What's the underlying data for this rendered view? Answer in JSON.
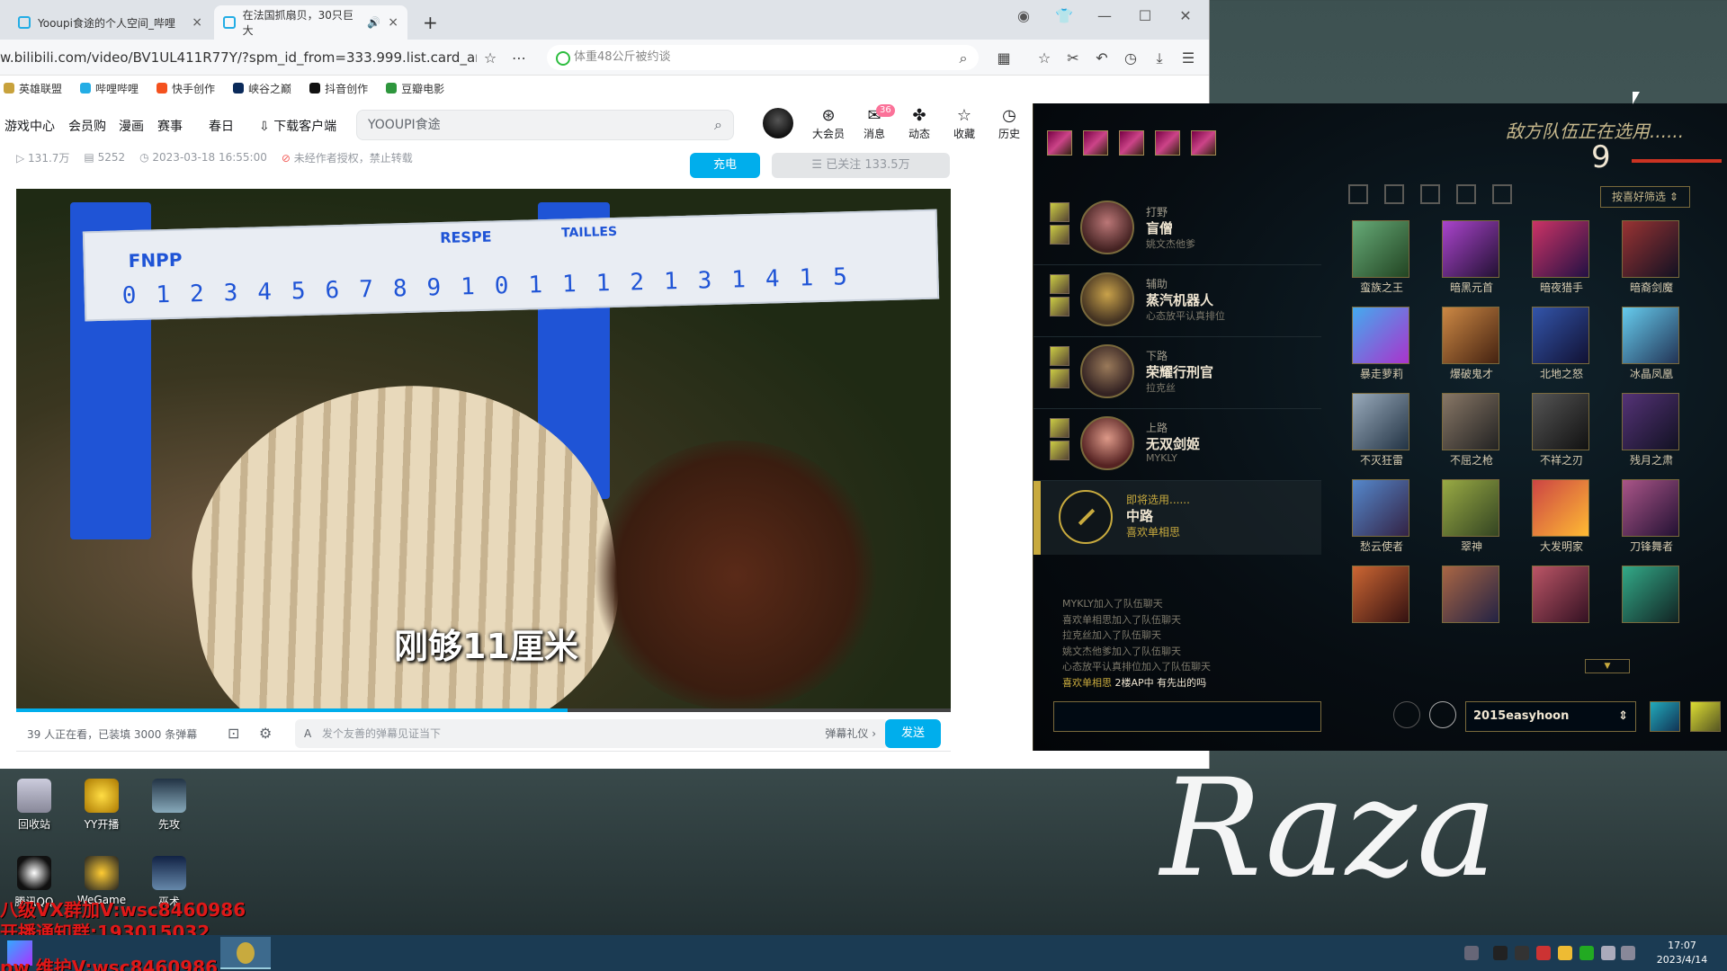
{
  "browser": {
    "tabs": [
      {
        "title": "Yooupi食途的个人空间_哔哩"
      },
      {
        "title": "在法国抓扇贝，30只巨大"
      }
    ],
    "url": "w.bilibili.com/video/BV1UL411R77Y/?spm_id_from=333.999.list.card_archive.clic",
    "search_hint": "体重48公斤被约谈",
    "bookmarks": [
      "英雄联盟",
      "哔哩哔哩",
      "快手创作",
      "峡谷之巅",
      "抖音创作",
      "豆瓣电影"
    ]
  },
  "bilibili": {
    "nav": [
      "游戏中心",
      "会员购",
      "漫画",
      "赛事",
      "春日",
      "下载客户端"
    ],
    "search_text": "YOOUPI食途",
    "header_icons": [
      {
        "label": "大会员",
        "badge": ""
      },
      {
        "label": "消息",
        "badge": "36"
      },
      {
        "label": "动态",
        "badge": ""
      },
      {
        "label": "收藏",
        "badge": ""
      },
      {
        "label": "历史",
        "badge": ""
      }
    ],
    "meta": {
      "views": "131.7万",
      "danmaku": "5252",
      "date": "2023-03-18 16:55:00",
      "notice": "未经作者授权，禁止转载"
    },
    "charge_label": "充电",
    "follow_label": "已关注 133.5万",
    "video": {
      "subtitle": "刚够11厘米",
      "ruler_brand": "FNPP",
      "ruler_text": "RESPE",
      "ruler_tailles": "TAILLES",
      "ruler_numbers": "0123456789101112131415",
      "progress": 0.59
    },
    "danmaku_bar": {
      "viewers": "39 人正在看，已装填 3000 条弹幕",
      "placeholder": "发个友善的弹幕见证当下",
      "etiquette": "弹幕礼仪 ›",
      "send": "发送"
    }
  },
  "game": {
    "enemy_title": "敌方队伍正在选用......",
    "timer": "9",
    "filter": "按喜好筛选",
    "team": [
      {
        "position": "打野",
        "champion": "盲僧",
        "player": "姚文杰他爹"
      },
      {
        "position": "辅助",
        "champion": "蒸汽机器人",
        "player": "心态放平认真排位"
      },
      {
        "position": "下路",
        "champion": "荣耀行刑官",
        "player": "拉克丝"
      },
      {
        "position": "上路",
        "champion": "无双剑姬",
        "player": "MYKLY"
      }
    ],
    "picking": {
      "status": "即将选用......",
      "position": "中路",
      "player": "喜欢单相思"
    },
    "chat": [
      "MYKLY加入了队伍聊天",
      "喜欢单相思加入了队伍聊天",
      "拉克丝加入了队伍聊天",
      "姚文杰他爹加入了队伍聊天",
      "心态放平认真排位加入了队伍聊天"
    ],
    "chat_last": {
      "speaker": "喜欢单相思",
      "message": "2楼AP中 有先出的吗"
    },
    "champions": [
      "蛮族之王",
      "暗黑元首",
      "暗夜猎手",
      "暗裔剑魔",
      "暴走萝莉",
      "爆破鬼才",
      "北地之怒",
      "冰晶凤凰",
      "不灭狂雷",
      "不屈之枪",
      "不祥之刃",
      "残月之肃",
      "drawn_placeholder_ignore"
    ],
    "champions_row4": [
      "愁云使者",
      "翠神",
      "大发明家",
      "刀锋舞者"
    ],
    "skin": "2015easyhoon"
  },
  "desktop": {
    "icons": [
      {
        "label": "回收站"
      },
      {
        "label": "YY开播"
      },
      {
        "label": "先攻"
      },
      {
        "label": "腾讯QQ"
      },
      {
        "label": "WeGame"
      },
      {
        "label": "巫术"
      }
    ],
    "overlay": [
      "八级VX群加V:wsc8460986",
      "开播通知群:193015032",
      "pw 维护V:wsc8460986"
    ],
    "signature": "Raza",
    "clock_time": "17:07",
    "clock_date": "2023/4/14"
  }
}
